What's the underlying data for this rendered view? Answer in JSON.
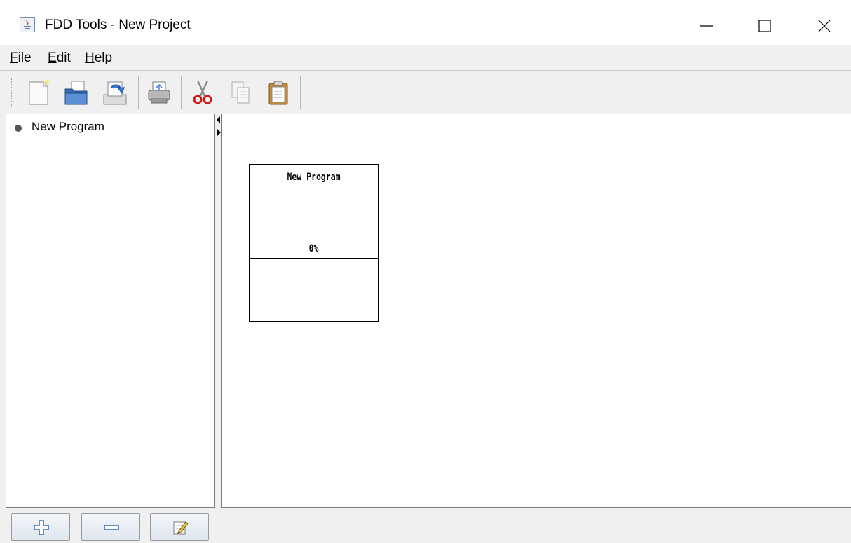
{
  "window": {
    "title": "FDD Tools - New Project"
  },
  "menu": {
    "file": {
      "mnemonic": "F",
      "rest": "ile"
    },
    "edit": {
      "mnemonic": "E",
      "rest": "dit"
    },
    "help": {
      "mnemonic": "H",
      "rest": "elp"
    }
  },
  "toolbar": {
    "buttons": [
      "new-icon",
      "open-icon",
      "save-icon",
      "print-icon",
      "cut-icon",
      "copy-icon",
      "paste-icon"
    ]
  },
  "tree": {
    "items": [
      {
        "label": "New Program"
      }
    ]
  },
  "canvas": {
    "program_name": "New Program",
    "progress_label": "0%",
    "progress": 0
  },
  "bottom_buttons": [
    "add-icon",
    "remove-icon",
    "edit-icon"
  ],
  "colors": {
    "accent_blue": "#3a7bd5",
    "cut_red": "#d11a1a"
  }
}
